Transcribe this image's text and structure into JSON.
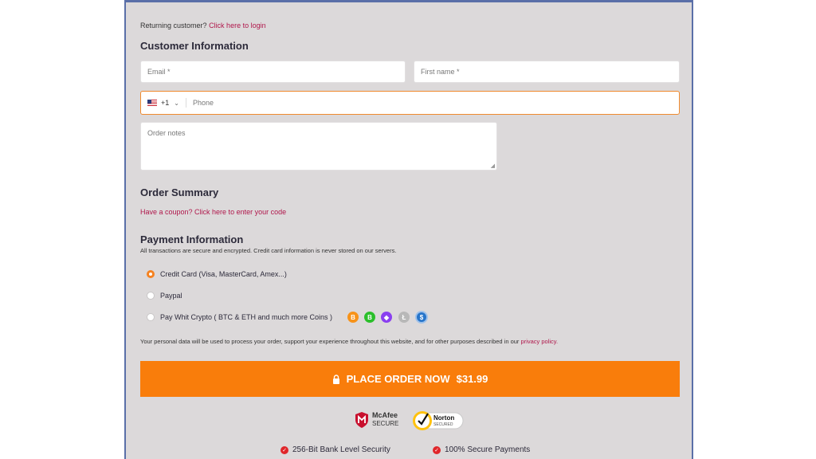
{
  "returning": {
    "text": "Returning customer?",
    "link": "Click here to login"
  },
  "customer_info": {
    "title": "Customer Information",
    "email_placeholder": "Email *",
    "first_name_placeholder": "First name *",
    "phone_code": "+1",
    "phone_placeholder": "Phone",
    "notes_placeholder": "Order notes"
  },
  "order_summary": {
    "title": "Order Summary",
    "coupon_link": "Have a coupon? Click here to enter your code"
  },
  "payment": {
    "title": "Payment Information",
    "subtitle": "All transactions are secure and encrypted. Credit card information is never stored on our servers.",
    "options": [
      {
        "label": "Credit Card (Visa, MasterCard, Amex...)",
        "selected": true
      },
      {
        "label": "Paypal",
        "selected": false
      },
      {
        "label": "Pay Whit Crypto ( BTC & ETH and much more Coins )",
        "selected": false
      }
    ],
    "coins": [
      {
        "icon": "bitcoin-icon",
        "glyph": "B",
        "color": "#f7931a"
      },
      {
        "icon": "bitcoin-cash-icon",
        "glyph": "B",
        "color": "#2bbf2b"
      },
      {
        "icon": "ethereum-icon",
        "glyph": "◆",
        "color": "#8a3ff0"
      },
      {
        "icon": "litecoin-icon",
        "glyph": "Ł",
        "color": "#b8b8b8"
      },
      {
        "icon": "usdc-icon",
        "glyph": "$",
        "color": "#2775ca"
      }
    ]
  },
  "privacy": {
    "text": "Your personal data will be used to process your order, support your experience throughout this website, and for other purposes described in our",
    "link": "privacy policy."
  },
  "place_order": {
    "label": "PLACE ORDER NOW",
    "price": "$31.99"
  },
  "badges": {
    "mcafee_line1": "McAfee",
    "mcafee_line2": "SECURE",
    "norton_line1": "Norton",
    "norton_line2": "SECURED"
  },
  "security": [
    "256-Bit Bank Level Security",
    "100% Secure Payments"
  ],
  "colors": {
    "accent": "#f97d0b",
    "link": "#b0174b",
    "panel_bg": "#dcd9da"
  }
}
